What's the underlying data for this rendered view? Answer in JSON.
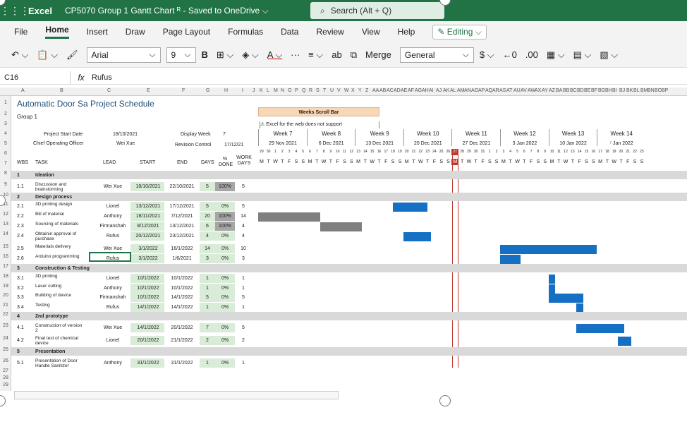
{
  "titlebar": {
    "app": "Excel",
    "doc": "CP5070 Group 1 Gantt Chart ᴿ - Saved to OneDrive ⌵",
    "search": "Search (Alt + Q)"
  },
  "menu": [
    "File",
    "Home",
    "Insert",
    "Draw",
    "Page Layout",
    "Formulas",
    "Data",
    "Review",
    "View",
    "Help"
  ],
  "editing": "✎ Editing ⌵",
  "toolbar": {
    "font": "Arial",
    "size": "9",
    "merge": "Merge",
    "format": "General",
    "currency": "$"
  },
  "formula": {
    "namebox": "C16",
    "fx": "fx",
    "content": "Rufus"
  },
  "colletters": [
    "A",
    "B",
    "C",
    "E",
    "F",
    "G",
    "H",
    "I",
    "J",
    "K",
    "L",
    "M",
    "N",
    "O",
    "P",
    "Q",
    "R",
    "S",
    "T",
    "U",
    "V",
    "W",
    "X",
    "Y",
    "Z",
    "AA",
    "AB",
    "AC",
    "AD",
    "AE",
    "AF",
    "AG",
    "AH",
    "AI",
    "AJ",
    "AK",
    "AL",
    "AM",
    "AN",
    "AO",
    "AP",
    "AQ",
    "AR",
    "AS",
    "AT",
    "AU",
    "AV",
    "AW",
    "AX",
    "AY",
    "AZ",
    "BA",
    "BB",
    "BC",
    "BD",
    "BE",
    "BF",
    "BG",
    "BH",
    "BI",
    "BJ",
    "BK",
    "BL",
    "BM",
    "BN",
    "BO",
    "BP"
  ],
  "sheet": {
    "title": "Automatic Door Sa Project Schedule",
    "group": "Group 1",
    "start_label": "Project Start Date",
    "start_value": "18/10/2021",
    "coo_label": "Chief Operating Officer",
    "coo_value": "Wei Xue",
    "display_week_label": "Display Week",
    "display_week_value": "7",
    "revision_label": "Revision Control",
    "revision_value": "17/12/21",
    "scrollbar_title": "Weeks Scroll Bar",
    "scrollbar_msg": "⚠ Excel for the web does not support",
    "headers": {
      "wbs": "WBS",
      "task": "TASK",
      "lead": "LEAD",
      "start": "START",
      "end": "END",
      "days": "DAYS",
      "done": "% DONE",
      "work": "WORK DAYS"
    }
  },
  "weeks": [
    {
      "label": "Week 7",
      "date": "29 Nov 2021"
    },
    {
      "label": "Week 8",
      "date": "6 Dec 2021"
    },
    {
      "label": "Week 9",
      "date": "13 Dec 2021"
    },
    {
      "label": "Week 10",
      "date": "20 Dec 2021"
    },
    {
      "label": "Week 11",
      "date": "27 Dec 2021"
    },
    {
      "label": "Week 12",
      "date": "3 Jan 2022"
    },
    {
      "label": "Week 13",
      "date": "10 Jan 2022"
    },
    {
      "label": "Week 14",
      "date": "⁷ Jan 2022"
    }
  ],
  "daynums": [
    "29",
    "30",
    "1",
    "2",
    "3",
    "4",
    "5",
    "6",
    "7",
    "8",
    "9",
    "10",
    "11",
    "12",
    "13",
    "14",
    "15",
    "16",
    "17",
    "18",
    "19",
    "20",
    "21",
    "22",
    "23",
    "24",
    "25",
    "26",
    "27",
    "28",
    "29",
    "30",
    "31",
    "1",
    "2",
    "3",
    "4",
    "5",
    "6",
    "7",
    "8",
    "9",
    "10",
    "11",
    "12",
    "13",
    "14",
    "15",
    "16",
    "17",
    "18",
    "19",
    "20",
    "21",
    "22",
    "23"
  ],
  "dayletters": [
    "M",
    "T",
    "W",
    "T",
    "F",
    "S",
    "S",
    "M",
    "T",
    "W",
    "T",
    "F",
    "S",
    "S",
    "M",
    "T",
    "W",
    "T",
    "F",
    "S",
    "S",
    "M",
    "T",
    "W",
    "T",
    "F",
    "S",
    "S",
    "M",
    "T",
    "W",
    "T",
    "F",
    "S",
    "S",
    "M",
    "T",
    "W",
    "T",
    "F",
    "S",
    "S",
    "M",
    "T",
    "W",
    "T",
    "F",
    "S",
    "S",
    "M",
    "T",
    "W",
    "T",
    "F",
    "S",
    "S"
  ],
  "rows": [
    {
      "r": "8",
      "wbs": "1",
      "task": "Ideation",
      "section": true
    },
    {
      "r": "9",
      "wbs": "1.1",
      "task": "Discussion and brainstorming",
      "lead": "Wei Xue",
      "start": "18/10/2021",
      "end": "22/10/2021",
      "days": "5",
      "done": "100%",
      "work": "5"
    },
    {
      "r": "10",
      "wbs": "2",
      "task": "Design process",
      "section": true
    },
    {
      "r": "11",
      "wbs": "2.1",
      "task": "3D printing design",
      "lead": "Lionel",
      "start": "13/12/2021",
      "end": "17/12/2021",
      "days": "5",
      "done": "0%",
      "work": "5"
    },
    {
      "r": "12",
      "wbs": "2.2",
      "task": "Bill of material",
      "lead": "Anthony",
      "start": "18/11/2021",
      "end": "7/12/2021",
      "days": "20",
      "done": "100%",
      "work": "14"
    },
    {
      "r": "13",
      "wbs": "2.3",
      "task": "Sourcing of materials",
      "lead": "Firmanshah",
      "start": "8/12/2021",
      "end": "13/12/2021",
      "days": "6",
      "done": "100%",
      "work": "4"
    },
    {
      "r": "14",
      "wbs": "2.4",
      "task": "Obtainin approval of purchase",
      "lead": "Rufus",
      "start": "20/12/2021",
      "end": "23/12/2021",
      "days": "4",
      "done": "0%",
      "work": "4"
    },
    {
      "r": "15",
      "wbs": "2.5",
      "task": "Materials delivery",
      "lead": "Wei Xue",
      "start": "3/1/2022",
      "end": "16/1/2022",
      "days": "14",
      "done": "0%",
      "work": "10"
    },
    {
      "r": "16",
      "wbs": "2.6",
      "task": "Arduino programming",
      "lead": "Rufus",
      "start": "3/1/2022",
      "end": "1/6/2021",
      "days": "3",
      "done": "0%",
      "work": "3"
    },
    {
      "r": "17",
      "wbs": "3",
      "task": "Construction & Testing",
      "section": true
    },
    {
      "r": "18",
      "wbs": "3.1",
      "task": "3D printing",
      "lead": "Lionel",
      "start": "10/1/2022",
      "end": "10/1/2022",
      "days": "1",
      "done": "0%",
      "work": "1"
    },
    {
      "r": "19",
      "wbs": "3.2",
      "task": "Laser cutting",
      "lead": "Anthony",
      "start": "10/1/2022",
      "end": "10/1/2022",
      "days": "1",
      "done": "0%",
      "work": "1"
    },
    {
      "r": "20",
      "wbs": "3.3",
      "task": "Building of device",
      "lead": "Firmanshah",
      "start": "10/1/2022",
      "end": "14/1/2022",
      "days": "5",
      "done": "0%",
      "work": "5"
    },
    {
      "r": "21",
      "wbs": "3.4",
      "task": "Testing",
      "lead": "Rufus",
      "start": "14/1/2022",
      "end": "14/1/2022",
      "days": "1",
      "done": "0%",
      "work": "1"
    },
    {
      "r": "22",
      "wbs": "4",
      "task": "2nd prototype",
      "section": true
    },
    {
      "r": "23",
      "wbs": "4.1",
      "task": "Construction of version 2",
      "lead": "Wei Xue",
      "start": "14/1/2022",
      "end": "20/1/2022",
      "days": "7",
      "done": "0%",
      "work": "5"
    },
    {
      "r": "24",
      "wbs": "4.2",
      "task": "Final test of chemical device",
      "lead": "Lionel",
      "start": "20/1/2022",
      "end": "21/1/2022",
      "days": "2",
      "done": "0%",
      "work": "2"
    },
    {
      "r": "25",
      "wbs": "5",
      "task": "Presentation",
      "section": true
    },
    {
      "r": "26",
      "wbs": "5.1",
      "task": "Presentation of Door Handle Sanitizer",
      "lead": "Anthony",
      "start": "31/1/2022",
      "end": "31/1/2022",
      "days": "1",
      "done": "0%",
      "work": "1"
    }
  ],
  "colors": {
    "excel_green": "#217346",
    "bar_blue": "#1570c4",
    "bar_grey": "#7f7f7f",
    "today_red": "#c0392b",
    "done_green": "#d8ecd8"
  }
}
